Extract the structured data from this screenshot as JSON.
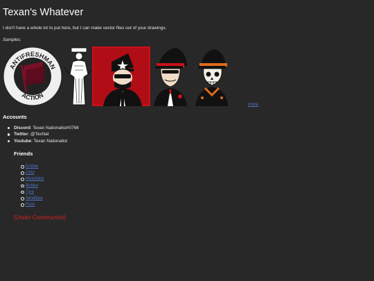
{
  "page": {
    "title": "Texan's Whatever",
    "intro": "I don't have a whole lot to put here, but I can make vector files out of your drawings.",
    "samples_label": "Samples:",
    "gallery": [
      {
        "icon": "antifreshman-action-logo",
        "text_top": "ANTIFRESHMAN",
        "text_bottom": "ACTION"
      },
      {
        "icon": "statue-figure-drawing"
      },
      {
        "icon": "masked-officer-red-badge"
      },
      {
        "icon": "officer-portrait-drawing"
      },
      {
        "icon": "skeleton-soldier-drawing"
      }
    ],
    "more_label": "more",
    "accounts_heading": "Accounts",
    "accounts": [
      {
        "key": "Discord",
        "value": ": Texan Nationalist#0768"
      },
      {
        "key": "Twitter",
        "value": ": @TexNat"
      },
      {
        "key": "Youtube",
        "value": ": Texan Nationalist"
      }
    ],
    "friends_heading": "Friends",
    "friends": [
      "Ember",
      "Cind",
      "Munchkin",
      "Bobbo",
      "Tyre",
      "Ilandiliea",
      "Frick"
    ],
    "construction": "[Under Construction]"
  },
  "colors": {
    "background": "#282828",
    "text": "#e6e6e6",
    "link": "#4d74c9",
    "construction": "#d82020"
  }
}
